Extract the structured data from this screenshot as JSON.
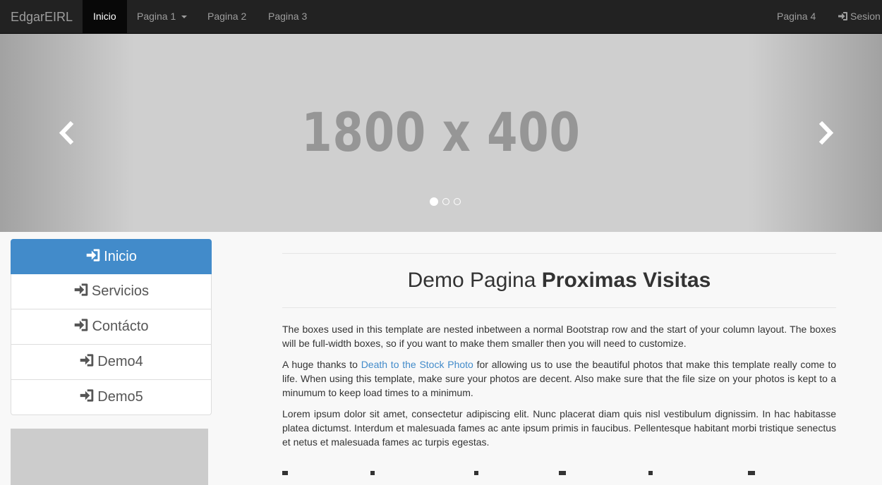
{
  "navbar": {
    "brand": "EdgarEIRL",
    "items": [
      {
        "label": "Inicio",
        "active": true
      },
      {
        "label": "Pagina 1",
        "dropdown": true
      },
      {
        "label": "Pagina 2"
      },
      {
        "label": "Pagina 3"
      }
    ],
    "right_items": [
      {
        "label": "Pagina 4"
      },
      {
        "label": "Sesion",
        "icon": "login-icon"
      }
    ]
  },
  "carousel": {
    "placeholder_text": "1800 x 400",
    "prev_icon": "chevron-left-icon",
    "next_icon": "chevron-right-icon",
    "slide_count": 3,
    "active_slide": 1
  },
  "sidebar": {
    "items": [
      {
        "label": "Inicio",
        "icon": "login-icon",
        "active": true
      },
      {
        "label": "Servicios",
        "icon": "login-icon"
      },
      {
        "label": "Contácto",
        "icon": "login-icon"
      },
      {
        "label": "Demo4",
        "icon": "login-icon"
      },
      {
        "label": "Demo5",
        "icon": "login-icon"
      }
    ]
  },
  "content": {
    "title_plain": "Demo Pagina",
    "title_bold": "Proximas Visitas",
    "paragraph1": "The boxes used in this template are nested inbetween a normal Bootstrap row and the start of your column layout. The boxes will be full-width boxes, so if you want to make them smaller then you will need to customize.",
    "paragraph2_before": "A huge thanks to",
    "paragraph2_link": "Death to the Stock Photo",
    "paragraph2_after": "for allowing us to use the beautiful photos that make this template really come to life. When using this template, make sure your photos are decent. Also make sure that the file size on your photos is kept to a minumum to keep load times to a minimum.",
    "paragraph3": "Lorem ipsum dolor sit amet, consectetur adipiscing elit. Nunc placerat diam quis nisl vestibulum dignissim. In hac habitasse platea dictumst. Interdum et malesuada fames ac ante ipsum primis in faucibus. Pellentesque habitant morbi tristique senectus et netus et malesuada fames ac turpis egestas."
  },
  "colors": {
    "navbar_bg": "#222222",
    "accent": "#428bca",
    "link": "#428bca"
  }
}
